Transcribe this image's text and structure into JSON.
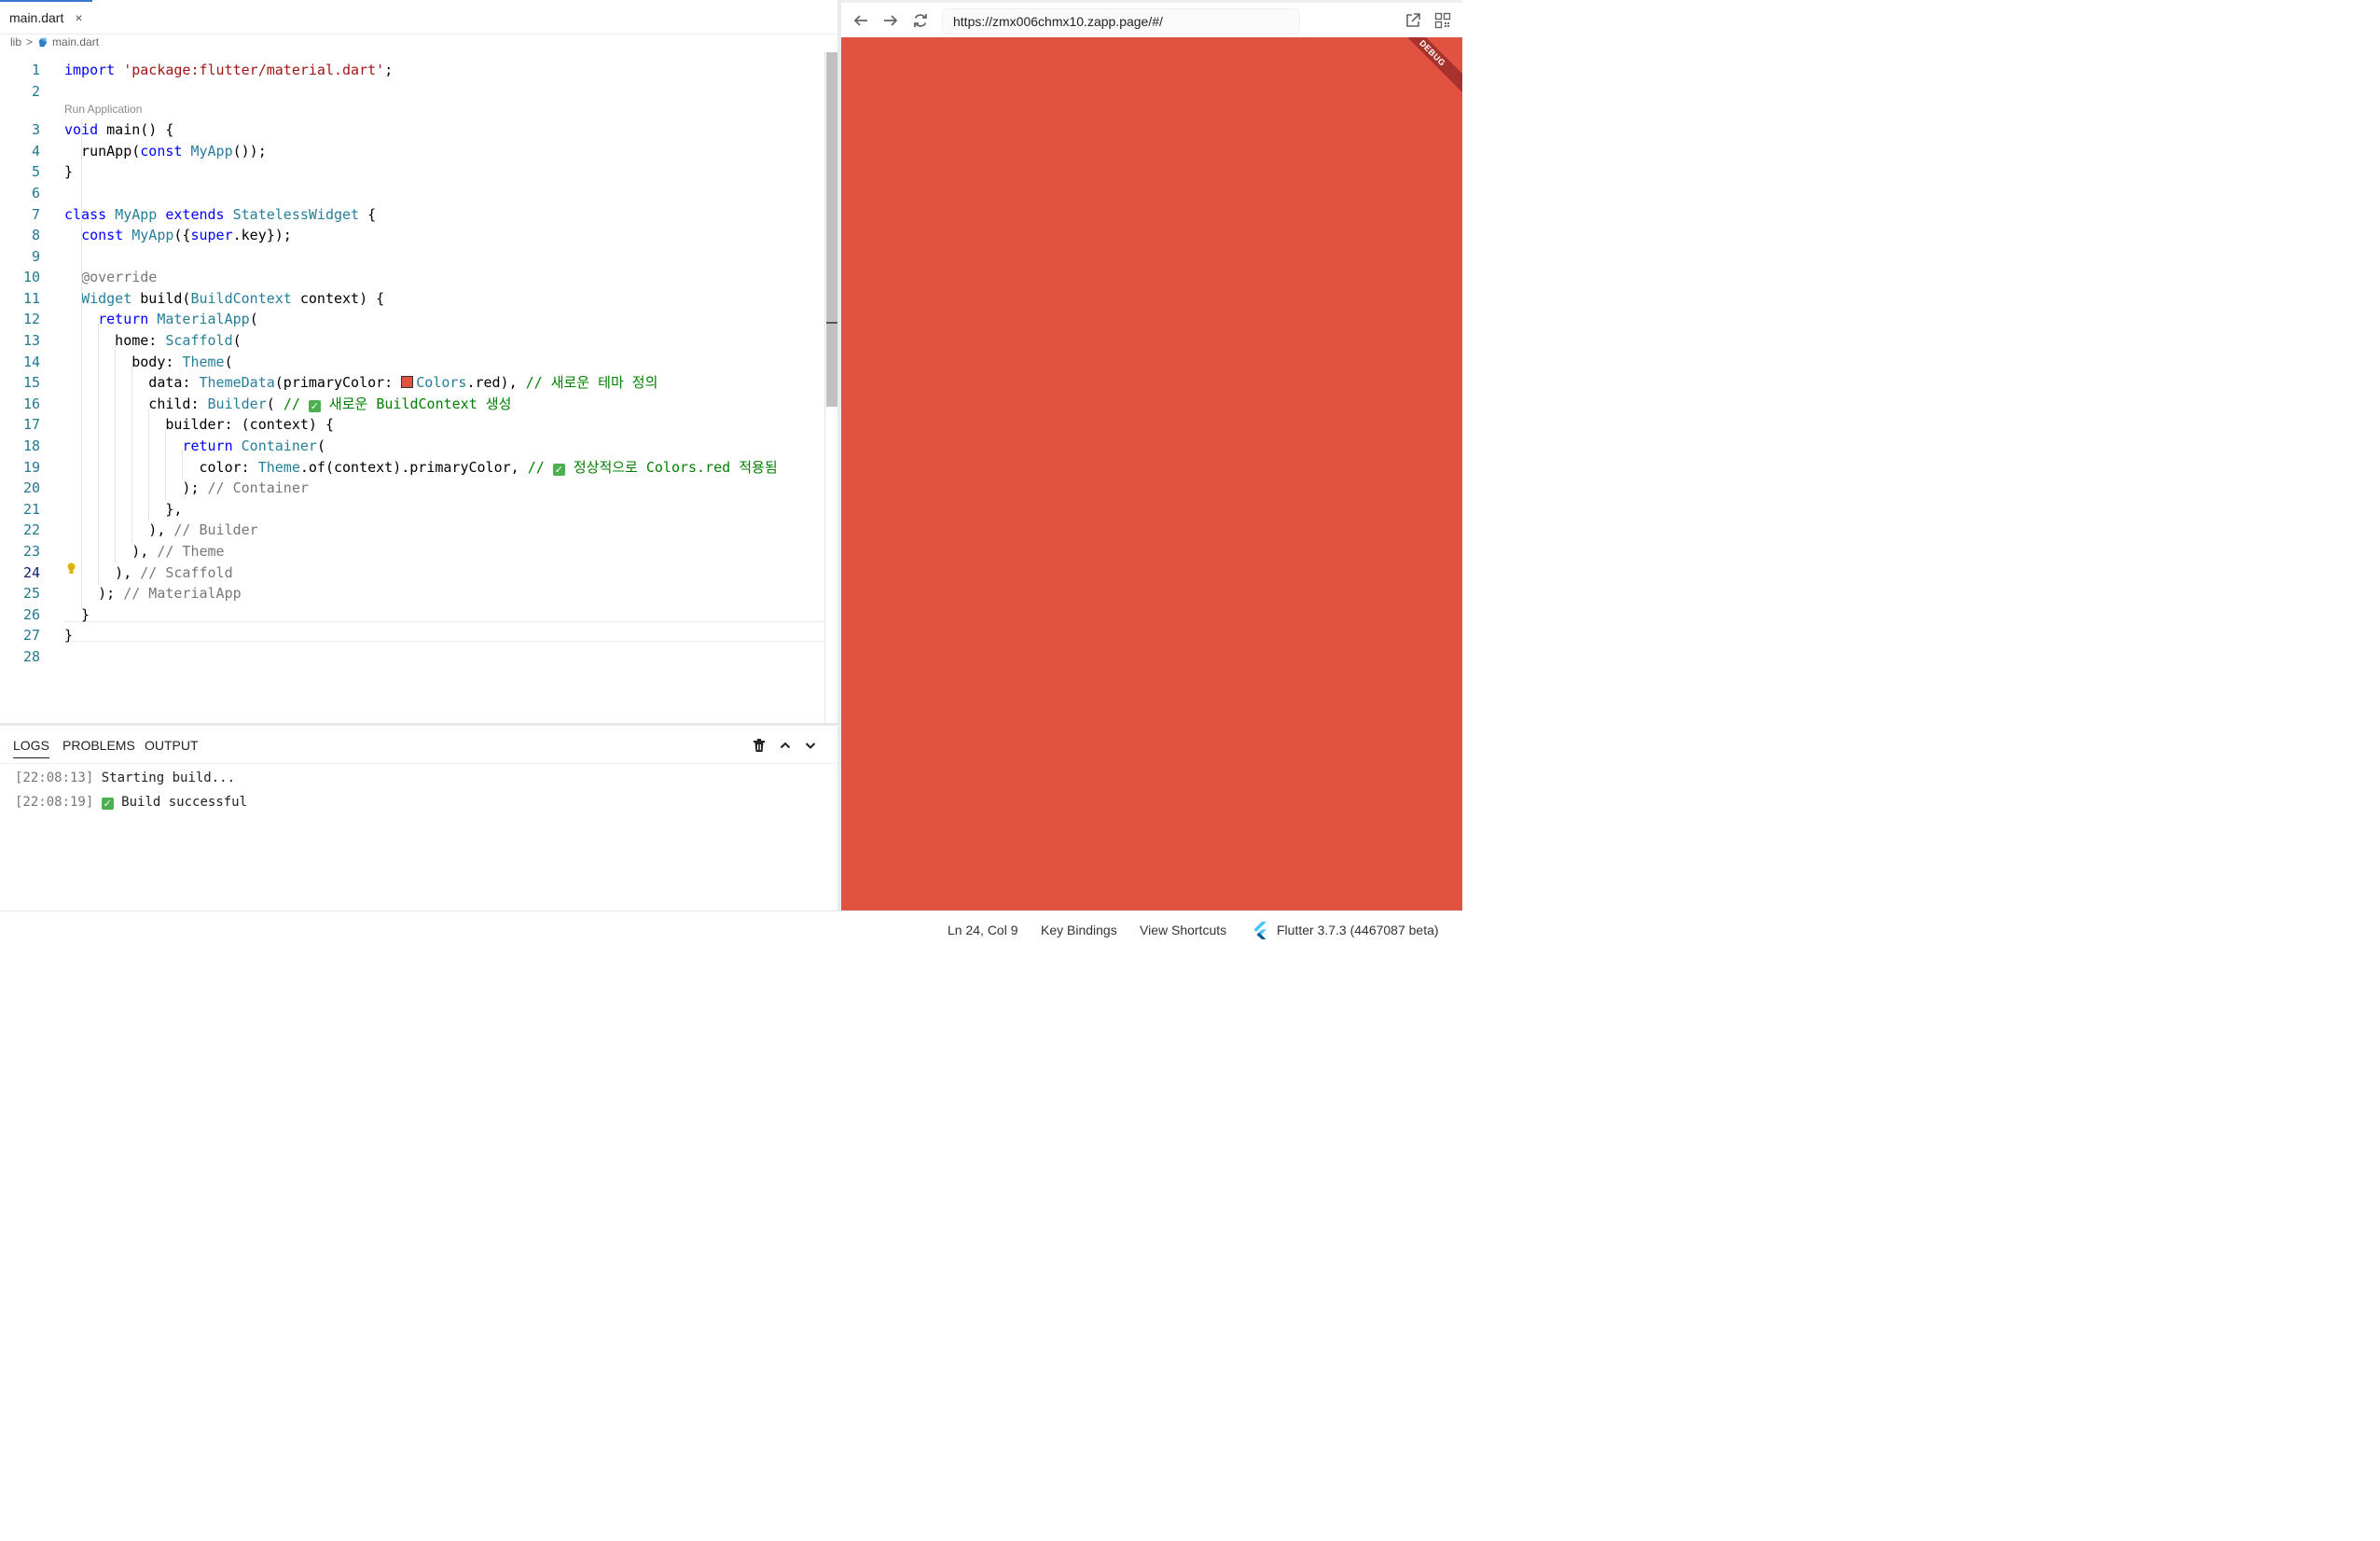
{
  "tab": {
    "label": "main.dart",
    "close": "×"
  },
  "breadcrumb": {
    "folder": "lib",
    "sep": ">",
    "file": "main.dart"
  },
  "codelens": "Run Application",
  "code": [
    {
      "n": "1",
      "segs": [
        [
          "kw",
          "import"
        ],
        [
          "pl",
          " "
        ],
        [
          "str",
          "'package:flutter/material.dart'"
        ],
        [
          "pl",
          ";"
        ]
      ]
    },
    {
      "n": "2",
      "segs": []
    },
    {
      "n": "3",
      "segs": [
        [
          "kw",
          "void"
        ],
        [
          "pl",
          " main() {"
        ]
      ]
    },
    {
      "n": "4",
      "segs": [
        [
          "pl",
          "  runApp("
        ],
        [
          "kw",
          "const"
        ],
        [
          "pl",
          " "
        ],
        [
          "ty",
          "MyApp"
        ],
        [
          "pl",
          "());"
        ]
      ]
    },
    {
      "n": "5",
      "segs": [
        [
          "pl",
          "}"
        ]
      ]
    },
    {
      "n": "6",
      "segs": []
    },
    {
      "n": "7",
      "segs": [
        [
          "kw",
          "class"
        ],
        [
          "pl",
          " "
        ],
        [
          "ty",
          "MyApp"
        ],
        [
          "pl",
          " "
        ],
        [
          "kw",
          "extends"
        ],
        [
          "pl",
          " "
        ],
        [
          "ty",
          "StatelessWidget"
        ],
        [
          "pl",
          " {"
        ]
      ]
    },
    {
      "n": "8",
      "segs": [
        [
          "pl",
          "  "
        ],
        [
          "kw",
          "const"
        ],
        [
          "pl",
          " "
        ],
        [
          "ty",
          "MyApp"
        ],
        [
          "pl",
          "({"
        ],
        [
          "kw",
          "super"
        ],
        [
          "pl",
          ".key});"
        ]
      ]
    },
    {
      "n": "9",
      "segs": []
    },
    {
      "n": "10",
      "segs": [
        [
          "pl",
          "  "
        ],
        [
          "gc",
          "@override"
        ]
      ]
    },
    {
      "n": "11",
      "segs": [
        [
          "pl",
          "  "
        ],
        [
          "ty",
          "Widget"
        ],
        [
          "pl",
          " build("
        ],
        [
          "ty",
          "BuildContext"
        ],
        [
          "pl",
          " context) {"
        ]
      ]
    },
    {
      "n": "12",
      "segs": [
        [
          "pl",
          "    "
        ],
        [
          "kw",
          "return"
        ],
        [
          "pl",
          " "
        ],
        [
          "ty",
          "MaterialApp"
        ],
        [
          "pl",
          "("
        ]
      ]
    },
    {
      "n": "13",
      "segs": [
        [
          "pl",
          "      home: "
        ],
        [
          "ty",
          "Scaffold"
        ],
        [
          "pl",
          "("
        ]
      ]
    },
    {
      "n": "14",
      "segs": [
        [
          "pl",
          "        body: "
        ],
        [
          "ty",
          "Theme"
        ],
        [
          "pl",
          "("
        ]
      ]
    },
    {
      "n": "15",
      "segs": [
        [
          "pl",
          "          data: "
        ],
        [
          "ty",
          "ThemeData"
        ],
        [
          "pl",
          "(primaryColor: "
        ],
        [
          "swatch",
          ""
        ],
        [
          "ty",
          "Colors"
        ],
        [
          "pl",
          ".red), "
        ],
        [
          "cm",
          "// 새로운 테마 정의"
        ]
      ]
    },
    {
      "n": "16",
      "segs": [
        [
          "pl",
          "          child: "
        ],
        [
          "ty",
          "Builder"
        ],
        [
          "pl",
          "( "
        ],
        [
          "cm",
          "// "
        ],
        [
          "check",
          ""
        ],
        [
          "cm",
          " 새로운 BuildContext 생성"
        ]
      ]
    },
    {
      "n": "17",
      "segs": [
        [
          "pl",
          "            builder: (context) {"
        ]
      ]
    },
    {
      "n": "18",
      "segs": [
        [
          "pl",
          "              "
        ],
        [
          "kw",
          "return"
        ],
        [
          "pl",
          " "
        ],
        [
          "ty",
          "Container"
        ],
        [
          "pl",
          "("
        ]
      ]
    },
    {
      "n": "19",
      "segs": [
        [
          "pl",
          "                color: "
        ],
        [
          "ty",
          "Theme"
        ],
        [
          "pl",
          ".of(context).primaryColor, "
        ],
        [
          "cm",
          "// "
        ],
        [
          "check",
          ""
        ],
        [
          "cm",
          " 정상적으로 Colors.red 적용됨"
        ]
      ]
    },
    {
      "n": "20",
      "segs": [
        [
          "pl",
          "              ); "
        ],
        [
          "gc",
          "// Container"
        ]
      ]
    },
    {
      "n": "21",
      "segs": [
        [
          "pl",
          "            },"
        ]
      ]
    },
    {
      "n": "22",
      "segs": [
        [
          "pl",
          "          ), "
        ],
        [
          "gc",
          "// Builder"
        ]
      ]
    },
    {
      "n": "23",
      "segs": [
        [
          "pl",
          "        ), "
        ],
        [
          "gc",
          "// Theme"
        ]
      ]
    },
    {
      "n": "24",
      "segs": [
        [
          "pl",
          "      ), "
        ],
        [
          "gc",
          "// Scaffold"
        ]
      ],
      "active": true
    },
    {
      "n": "25",
      "segs": [
        [
          "pl",
          "    ); "
        ],
        [
          "gc",
          "// MaterialApp"
        ]
      ]
    },
    {
      "n": "26",
      "segs": [
        [
          "pl",
          "  }"
        ]
      ]
    },
    {
      "n": "27",
      "segs": [
        [
          "pl",
          "}"
        ]
      ]
    },
    {
      "n": "28",
      "segs": []
    }
  ],
  "panel": {
    "tabs": {
      "logs": "LOGS",
      "problems": "PROBLEMS",
      "output": "OUTPUT"
    },
    "logs": [
      {
        "time": "[22:08:13]",
        "msg": "Starting build...",
        "check": false
      },
      {
        "time": "[22:08:19]",
        "msg": "Build successful",
        "check": true
      }
    ]
  },
  "browser": {
    "url": "https://zmx006chmx10.zapp.page/#/",
    "debug": "DEBUG",
    "preview_color": "#e15241"
  },
  "status": {
    "position": "Ln 24, Col 9",
    "key_bindings": "Key Bindings",
    "view_shortcuts": "View Shortcuts",
    "flutter": "Flutter 3.7.3  (4467087 beta)"
  }
}
